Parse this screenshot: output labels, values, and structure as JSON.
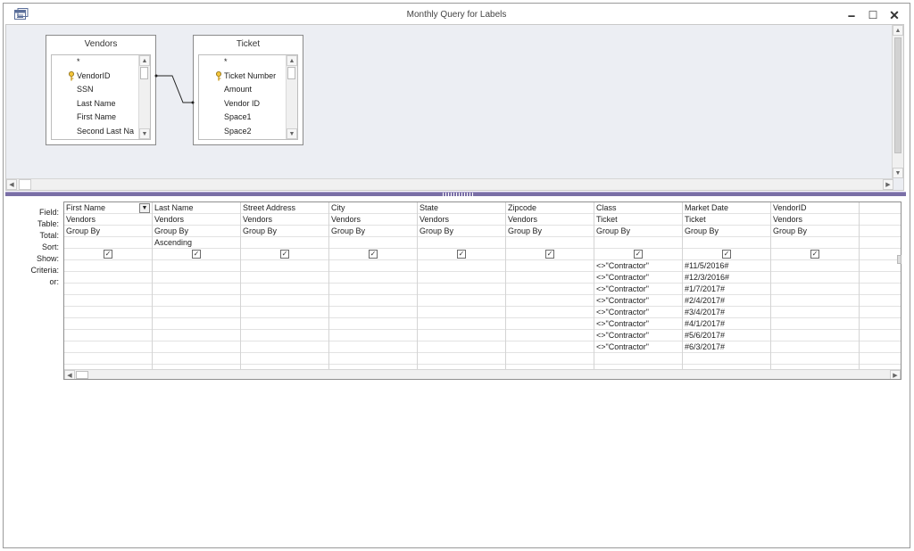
{
  "window": {
    "title": "Monthly Query for Labels",
    "minimize_glyph": "🗕",
    "maximize_glyph": "☐",
    "close_glyph": "✕"
  },
  "tables": [
    {
      "name": "Vendors",
      "fields": [
        "*",
        "VendorID",
        "SSN",
        "Last Name",
        "First Name",
        "Second Last Na"
      ],
      "key_field_index": 1
    },
    {
      "name": "Ticket",
      "fields": [
        "*",
        "Ticket Number",
        "Amount",
        "Vendor ID",
        "Space1",
        "Space2"
      ],
      "key_field_index": 1
    }
  ],
  "row_labels": [
    "Field:",
    "Table:",
    "Total:",
    "Sort:",
    "Show:",
    "Criteria:",
    "or:"
  ],
  "columns": [
    {
      "field": "First Name",
      "table": "Vendors",
      "total": "Group By",
      "sort": "",
      "show": true,
      "criteria": [],
      "has_dropdown": true
    },
    {
      "field": "Last Name",
      "table": "Vendors",
      "total": "Group By",
      "sort": "Ascending",
      "show": true,
      "criteria": []
    },
    {
      "field": "Street Address",
      "table": "Vendors",
      "total": "Group By",
      "sort": "",
      "show": true,
      "criteria": []
    },
    {
      "field": "City",
      "table": "Vendors",
      "total": "Group By",
      "sort": "",
      "show": true,
      "criteria": []
    },
    {
      "field": "State",
      "table": "Vendors",
      "total": "Group By",
      "sort": "",
      "show": true,
      "criteria": []
    },
    {
      "field": "Zipcode",
      "table": "Vendors",
      "total": "Group By",
      "sort": "",
      "show": true,
      "criteria": []
    },
    {
      "field": "Class",
      "table": "Ticket",
      "total": "Group By",
      "sort": "",
      "show": true,
      "criteria": [
        "<>\"Contractor\"",
        "<>\"Contractor\"",
        "<>\"Contractor\"",
        "<>\"Contractor\"",
        "<>\"Contractor\"",
        "<>\"Contractor\"",
        "<>\"Contractor\"",
        "<>\"Contractor\""
      ]
    },
    {
      "field": "Market Date",
      "table": "Ticket",
      "total": "Group By",
      "sort": "",
      "show": true,
      "criteria": [
        "#11/5/2016#",
        "#12/3/2016#",
        "#1/7/2017#",
        "#2/4/2017#",
        "#3/4/2017#",
        "#4/1/2017#",
        "#5/6/2017#",
        "#6/3/2017#"
      ]
    },
    {
      "field": "VendorID",
      "table": "Vendors",
      "total": "Group By",
      "sort": "",
      "show": true,
      "criteria": []
    },
    {
      "field": "",
      "table": "",
      "total": "",
      "sort": "",
      "show": false,
      "criteria": []
    }
  ],
  "icons": {
    "scroll_up": "▲",
    "scroll_down": "▼",
    "scroll_left": "◀",
    "scroll_right": "▶",
    "checkbox_mark": "✓",
    "dropdown": "▼"
  }
}
